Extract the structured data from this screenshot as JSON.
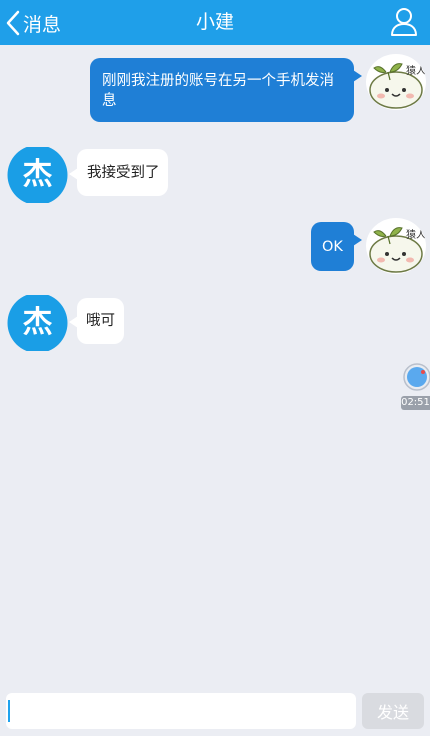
{
  "header": {
    "back_label": "消息",
    "title": "小建"
  },
  "messages": [
    {
      "side": "out",
      "text": "刚刚我注册的账号在另一个手机发消息"
    },
    {
      "side": "in",
      "text": "我接受到了",
      "avatar_char": "杰"
    },
    {
      "side": "out",
      "text": "OK"
    },
    {
      "side": "in",
      "text": "哦可",
      "avatar_char": "杰"
    }
  ],
  "voice": {
    "time": "02:51"
  },
  "composer": {
    "input_value": "",
    "send_label": "发送"
  },
  "colors": {
    "header": "#1f9fe9",
    "outgoing_bubble": "#1f7fd6",
    "incoming_bubble": "#ffffff",
    "background": "#ebedf3",
    "contact_avatar": "#1a9ee6"
  }
}
